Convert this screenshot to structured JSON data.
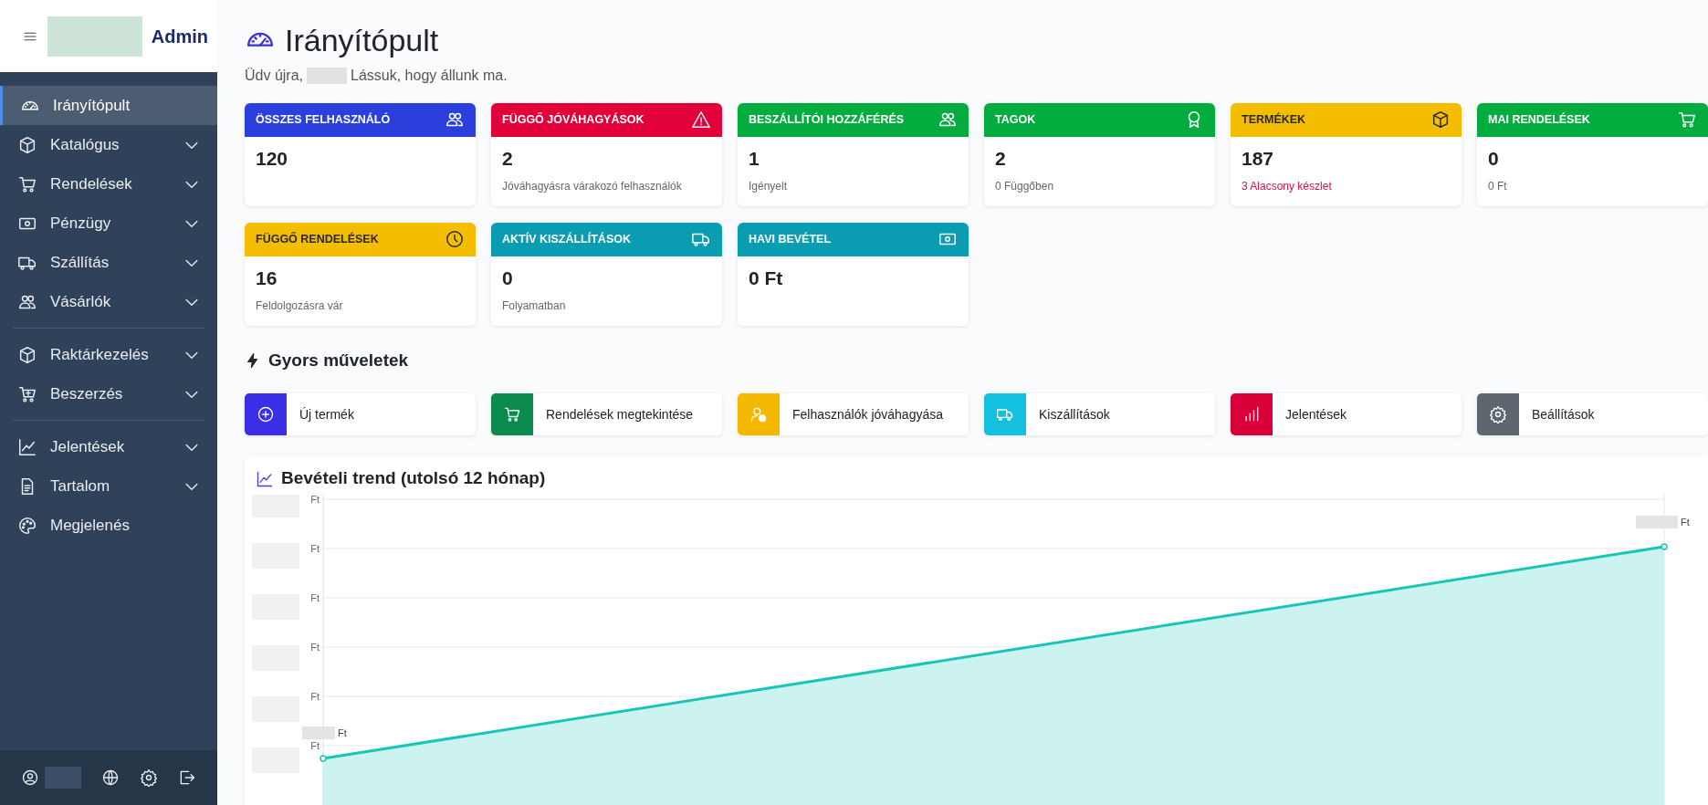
{
  "sidebar": {
    "brand": "Admin",
    "sections": [
      [
        {
          "label": "Irányítópult",
          "expandable": false,
          "selected": true
        },
        {
          "label": "Katalógus",
          "expandable": true,
          "selected": false
        },
        {
          "label": "Rendelések",
          "expandable": true,
          "selected": false
        },
        {
          "label": "Pénzügy",
          "expandable": true,
          "selected": false
        },
        {
          "label": "Szállítás",
          "expandable": true,
          "selected": false
        },
        {
          "label": "Vásárlók",
          "expandable": true,
          "selected": false
        }
      ],
      [
        {
          "label": "Raktárkezelés",
          "expandable": true,
          "selected": false
        },
        {
          "label": "Beszerzés",
          "expandable": true,
          "selected": false
        }
      ],
      [
        {
          "label": "Jelentések",
          "expandable": true,
          "selected": false
        },
        {
          "label": "Tartalom",
          "expandable": true,
          "selected": false
        },
        {
          "label": "Megjelenés",
          "expandable": false,
          "selected": false
        }
      ]
    ]
  },
  "page": {
    "title": "Irányítópult",
    "greeting_before": "Üdv újra,",
    "greeting_after": "Lássuk, hogy állunk ma."
  },
  "stats": [
    {
      "title": "ÖSSZES FELHASZNÁLÓ",
      "color": "#2a3fdc",
      "value": "120"
    },
    {
      "title": "FÜGGŐ JÓVÁHAGYÁSOK",
      "color": "#e2003b",
      "value": "2",
      "note": "Jóváhagyásra várakozó felhasználók",
      "alert": false
    },
    {
      "title": "BESZÁLLÍTÓI HOZZÁFÉRÉS",
      "color": "#03ac3f",
      "value": "1",
      "note": "Igényelt",
      "alert": false
    },
    {
      "title": "TAGOK",
      "color": "#03ac3f",
      "value": "2",
      "note": "0 Függőben",
      "alert": false
    },
    {
      "title": "TERMÉKEK",
      "color": "#f5bd00",
      "value": "187",
      "note": "3 Alacsony készlet",
      "alert": true
    },
    {
      "title": "MAI RENDELÉSEK",
      "color": "#03ac3f",
      "value": "0",
      "note": "0 Ft",
      "alert": false
    },
    {
      "title": "FÜGGŐ RENDELÉSEK",
      "color": "#f5bd00",
      "value": "16",
      "note": "Feldolgozásra vár",
      "alert": false
    },
    {
      "title": "AKTÍV KISZÁLLÍTÁSOK",
      "color": "#0a9cb0",
      "value": "0",
      "note": "Folyamatban",
      "alert": false
    },
    {
      "title": "HAVI BEVÉTEL",
      "color": "#0a9cb0",
      "value": "0 Ft"
    }
  ],
  "quick_actions": {
    "title": "Gyors műveletek",
    "items": [
      {
        "label": "Új termék",
        "color": "#3a2ee6"
      },
      {
        "label": "Rendelések megtekintése",
        "color": "#0a8a4c"
      },
      {
        "label": "Felhasználók jóváhagyása",
        "color": "#f4b800"
      },
      {
        "label": "Kiszállítások",
        "color": "#13c0dd"
      },
      {
        "label": "Jelentések",
        "color": "#d9003a"
      },
      {
        "label": "Beállítások",
        "color": "#5e666f"
      }
    ]
  },
  "chart": {
    "title": "Bevételi trend (utolsó 12 hónap)",
    "y_tick_labels": [
      "Ft",
      "Ft",
      "Ft",
      "Ft",
      "Ft",
      "Ft"
    ],
    "point_labels": [
      "Ft",
      "Ft"
    ]
  }
}
